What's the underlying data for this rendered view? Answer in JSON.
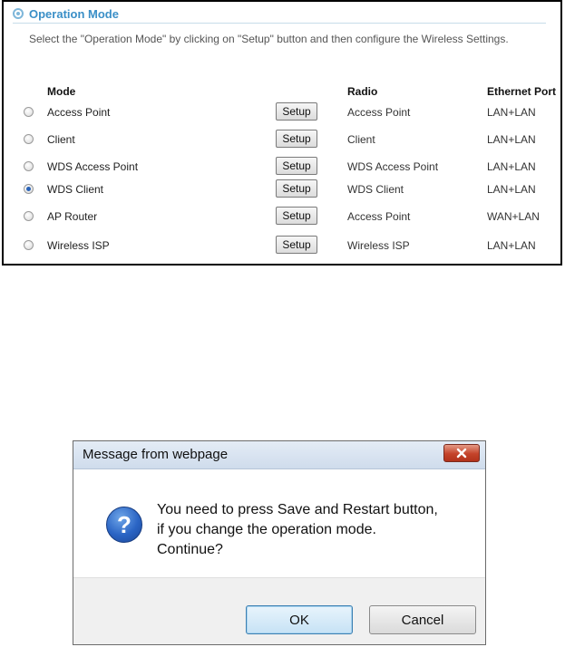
{
  "panel": {
    "title": "Operation Mode",
    "intro": "Select the \"Operation Mode\" by clicking on \"Setup\" button and then configure the Wireless Settings.",
    "headers": {
      "mode": "Mode",
      "radio": "Radio",
      "ethernet": "Ethernet Port"
    },
    "rows": [
      {
        "mode": "Access Point",
        "setup": "Setup",
        "radio": "Access Point",
        "ethernet": "LAN+LAN",
        "selected": false
      },
      {
        "mode": "Client",
        "setup": "Setup",
        "radio": "Client",
        "ethernet": "LAN+LAN",
        "selected": false
      },
      {
        "mode": "WDS Access Point",
        "setup": "Setup",
        "radio": "WDS Access Point",
        "ethernet": "LAN+LAN",
        "selected": false
      },
      {
        "mode": "WDS Client",
        "setup": "Setup",
        "radio": "WDS Client",
        "ethernet": "LAN+LAN",
        "selected": true
      },
      {
        "mode": "AP Router",
        "setup": "Setup",
        "radio": "Access Point",
        "ethernet": "WAN+LAN",
        "selected": false
      },
      {
        "mode": "Wireless ISP",
        "setup": "Setup",
        "radio": "Wireless ISP",
        "ethernet": "LAN+LAN",
        "selected": false
      }
    ]
  },
  "dialog": {
    "title": "Message from webpage",
    "icon": "question-icon",
    "message_lines": [
      "You need to press Save and Restart button,",
      " if you change the operation mode.",
      "Continue?"
    ],
    "ok_label": "OK",
    "cancel_label": "Cancel"
  }
}
